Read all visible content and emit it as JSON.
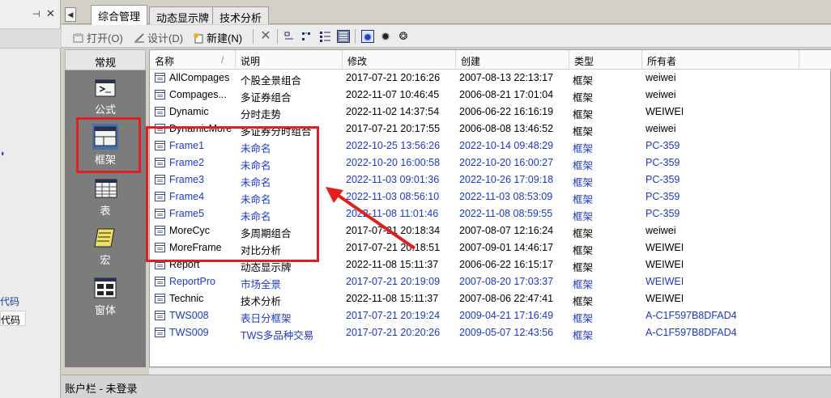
{
  "left_dock": {
    "pin_icon": "pin-icon",
    "close_label": "✕",
    "code_label_1": "代码",
    "code_label_2": "代码"
  },
  "tabs": [
    {
      "label": "综合管理",
      "active": true
    },
    {
      "label": "动态显示牌",
      "active": false
    },
    {
      "label": "技术分析",
      "active": false
    }
  ],
  "toolbar": {
    "open_label": "打开(O)",
    "design_label": "设计(D)",
    "new_label": "新建(N)",
    "icons": [
      "delete-icon",
      "view-large-icon",
      "view-small-icon",
      "view-list-icon",
      "view-details-icon",
      "settings-blue-icon",
      "settings-dark-icon",
      "export-icon"
    ]
  },
  "categories": {
    "header": "常规",
    "items": [
      {
        "label": "公式",
        "icon": "formula-icon"
      },
      {
        "label": "框架",
        "icon": "frame-icon",
        "selected": true
      },
      {
        "label": "表",
        "icon": "table-icon"
      },
      {
        "label": "宏",
        "icon": "macro-icon"
      },
      {
        "label": "窗体",
        "icon": "form-icon"
      }
    ]
  },
  "table": {
    "columns": [
      "名称",
      "说明",
      "修改",
      "创建",
      "类型",
      "所有者"
    ],
    "sort_indicator": "/",
    "rows": [
      {
        "name": "AllCompages",
        "desc": "个股全景组合",
        "modified": "2017-07-21 20:16:26",
        "created": "2007-08-13 22:13:17",
        "type": "框架",
        "owner": "weiwei",
        "blue": false
      },
      {
        "name": "Compages...",
        "desc": "多证券组合",
        "modified": "2022-11-07 10:46:45",
        "created": "2006-08-21 17:01:04",
        "type": "框架",
        "owner": "weiwei",
        "blue": false
      },
      {
        "name": "Dynamic",
        "desc": "分时走势",
        "modified": "2022-11-02 14:37:54",
        "created": "2006-06-22 16:16:19",
        "type": "框架",
        "owner": "WEIWEI",
        "blue": false
      },
      {
        "name": "DynamicMore",
        "desc": "多证券分时组合",
        "modified": "2017-07-21 20:17:55",
        "created": "2006-08-08 13:46:52",
        "type": "框架",
        "owner": "weiwei",
        "blue": false
      },
      {
        "name": "Frame1",
        "desc": "未命名",
        "modified": "2022-10-25 13:56:26",
        "created": "2022-10-14 09:48:29",
        "type": "框架",
        "owner": "PC-359",
        "blue": true
      },
      {
        "name": "Frame2",
        "desc": "未命名",
        "modified": "2022-10-20 16:00:58",
        "created": "2022-10-20 16:00:27",
        "type": "框架",
        "owner": "PC-359",
        "blue": true
      },
      {
        "name": "Frame3",
        "desc": "未命名",
        "modified": "2022-11-03 09:01:36",
        "created": "2022-10-26 17:09:18",
        "type": "框架",
        "owner": "PC-359",
        "blue": true
      },
      {
        "name": "Frame4",
        "desc": "未命名",
        "modified": "2022-11-03 08:56:10",
        "created": "2022-11-03 08:53:09",
        "type": "框架",
        "owner": "PC-359",
        "blue": true
      },
      {
        "name": "Frame5",
        "desc": "未命名",
        "modified": "2022-11-08 11:01:46",
        "created": "2022-11-08 08:59:55",
        "type": "框架",
        "owner": "PC-359",
        "blue": true
      },
      {
        "name": "MoreCyc",
        "desc": "多周期组合",
        "modified": "2017-07-21 20:18:34",
        "created": "2007-08-07 12:16:24",
        "type": "框架",
        "owner": "weiwei",
        "blue": false
      },
      {
        "name": "MoreFrame",
        "desc": "对比分析",
        "modified": "2017-07-21 20:18:51",
        "created": "2007-09-01 14:46:17",
        "type": "框架",
        "owner": "WEIWEI",
        "blue": false
      },
      {
        "name": "Report",
        "desc": "动态显示牌",
        "modified": "2022-11-08 15:11:37",
        "created": "2006-06-22 16:15:17",
        "type": "框架",
        "owner": "WEIWEI",
        "blue": false
      },
      {
        "name": "ReportPro",
        "desc": "市场全景",
        "modified": "2017-07-21 20:19:09",
        "created": "2007-08-20 17:03:37",
        "type": "框架",
        "owner": "WEIWEI",
        "blue": true
      },
      {
        "name": "Technic",
        "desc": "技术分析",
        "modified": "2022-11-08 15:11:37",
        "created": "2007-08-06 22:47:41",
        "type": "框架",
        "owner": "WEIWEI",
        "blue": false
      },
      {
        "name": "TWS008",
        "desc": "表日分框架",
        "modified": "2017-07-21 20:19:24",
        "created": "2009-04-21 17:16:49",
        "type": "框架",
        "owner": "A-C1F597B8DFAD4",
        "blue": true
      },
      {
        "name": "TWS009",
        "desc": "TWS多品种交易",
        "modified": "2017-07-21 20:20:26",
        "created": "2009-05-07 12:43:56",
        "type": "框架",
        "owner": "A-C1F597B8DFAD4",
        "blue": true
      }
    ]
  },
  "status": {
    "text": "账户栏 - 未登录"
  },
  "colors": {
    "highlight": "#e02020",
    "blue_row": "#1d39c4"
  }
}
